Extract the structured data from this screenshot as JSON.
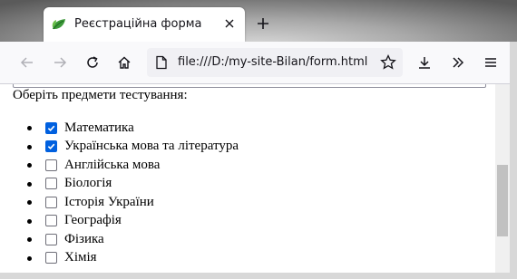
{
  "browser": {
    "tab": {
      "title": "Реєстраційна форма",
      "favicon": "leaf-icon",
      "close_icon": "close-icon"
    },
    "new_tab_icon": "plus-icon",
    "toolbar": {
      "back_icon": "back-arrow-icon",
      "forward_icon": "forward-arrow-icon",
      "reload_icon": "reload-icon",
      "home_icon": "home-icon",
      "download_icon": "download-icon",
      "overflow_icon": "chevrons-right-icon",
      "menu_icon": "hamburger-menu-icon"
    },
    "urlbar": {
      "url": "file:///D:/my-site-Bilan/form.html",
      "page_icon": "file-icon",
      "bookmark_icon": "star-icon"
    }
  },
  "page": {
    "prompt": "Оберіть предмети тестування:",
    "subjects": [
      {
        "label": "Математика",
        "checked": true
      },
      {
        "label": "Українська мова та література",
        "checked": true
      },
      {
        "label": "Англійська мова",
        "checked": false
      },
      {
        "label": "Біологія",
        "checked": false
      },
      {
        "label": "Історія України",
        "checked": false
      },
      {
        "label": "Географія",
        "checked": false
      },
      {
        "label": "Фізика",
        "checked": false
      },
      {
        "label": "Хімія",
        "checked": false
      }
    ]
  },
  "scroll": {
    "thumb_start_fraction": 0.43,
    "thumb_end_fraction": 0.81
  },
  "colors": {
    "checkbox_checked": "#0060df",
    "favicon_leaf": "#3d9a3a"
  }
}
